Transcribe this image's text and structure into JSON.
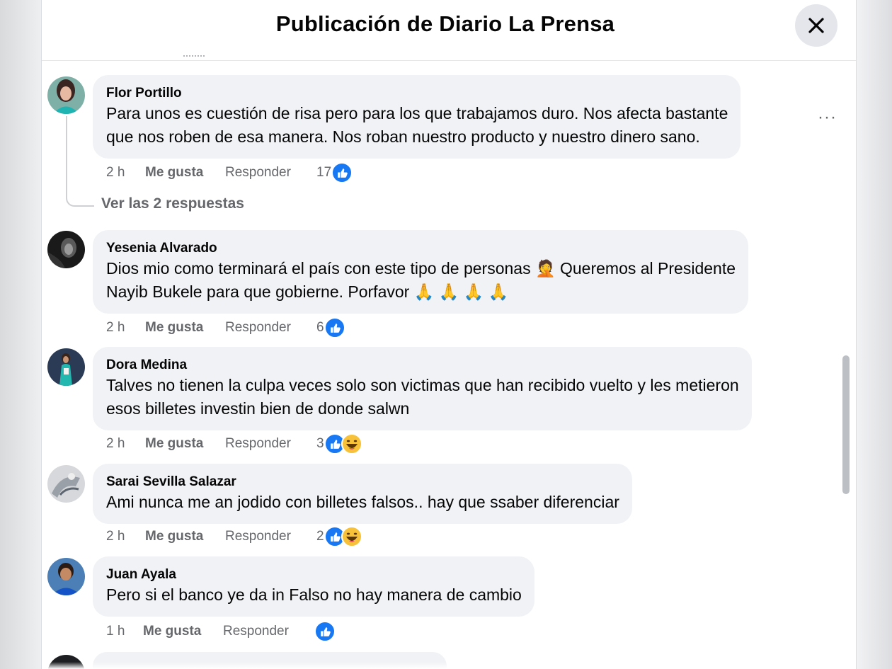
{
  "header": {
    "title": "Publicación de Diario La Prensa",
    "close_icon": "close-icon"
  },
  "thread": {
    "view_replies": "Ver las 2 respuestas"
  },
  "comments": [
    {
      "author": "Flor Portillo",
      "lines": [
        "Para unos es cuestión de risa pero para los que trabajamos duro. Nos afecta bastante",
        "que nos roben de esa manera. Nos roban nuestro producto y nuestro dinero sano."
      ],
      "time": "2 h",
      "like_label": "Me gusta",
      "reply_label": "Responder",
      "reaction_count": "17",
      "reactions": [
        "like"
      ],
      "more_label": "···"
    },
    {
      "author": "Yesenia Alvarado",
      "lines": [
        "Dios mio como terminará el país con este tipo de personas 🤦 Queremos al Presidente",
        "Nayib Bukele para que gobierne. Porfavor 🙏 🙏 🙏 🙏"
      ],
      "time": "2 h",
      "like_label": "Me gusta",
      "reply_label": "Responder",
      "reaction_count": "6",
      "reactions": [
        "like"
      ]
    },
    {
      "author": "Dora Medina",
      "lines": [
        "Talves no tienen la culpa veces solo son victimas que han recibido vuelto y les metieron",
        "esos billetes investin bien de donde salwn"
      ],
      "time": "2 h",
      "like_label": "Me gusta",
      "reply_label": "Responder",
      "reaction_count": "3",
      "reactions": [
        "like",
        "haha"
      ]
    },
    {
      "author": "Sarai Sevilla Salazar",
      "lines": [
        "Ami nunca me an jodido con billetes falsos.. hay que ssaber diferenciar"
      ],
      "time": "2 h",
      "like_label": "Me gusta",
      "reply_label": "Responder",
      "reaction_count": "2",
      "reactions": [
        "like",
        "haha"
      ]
    },
    {
      "author": "Juan Ayala",
      "lines": [
        "Pero si el banco ye da in Falso no hay manera de cambio"
      ],
      "time": "1 h",
      "like_label": "Me gusta",
      "reply_label": "Responder",
      "reaction_count": "",
      "reactions": [
        "like"
      ]
    }
  ],
  "colors": {
    "like_blue": "#1877f2",
    "bubble_bg": "#f0f2f5",
    "meta_gray": "#65676b"
  }
}
